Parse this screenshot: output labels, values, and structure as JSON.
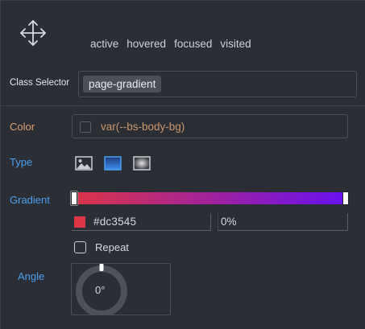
{
  "toolbar": {
    "states": [
      "active",
      "hovered",
      "focused",
      "visited"
    ]
  },
  "class_selector": {
    "label": "Class Selector",
    "tag": "page-gradient"
  },
  "color": {
    "label": "Color",
    "value": "var(--bs-body-bg)"
  },
  "type": {
    "label": "Type",
    "options": [
      "image-icon",
      "linear-gradient-icon",
      "radial-gradient-icon"
    ],
    "selected": "linear-gradient-icon"
  },
  "gradient": {
    "label": "Gradient",
    "start_color": "#dc3545",
    "end_color": "#6610f2",
    "stop_color": "#dc3545",
    "stop_position": "0%"
  },
  "repeat": {
    "label": "Repeat",
    "checked": false
  },
  "angle": {
    "label": "Angle",
    "value": "0°"
  },
  "colors": {
    "accent_label": "#4a9ff0",
    "color_label": "#d8a272",
    "background": "#2b2e35"
  }
}
